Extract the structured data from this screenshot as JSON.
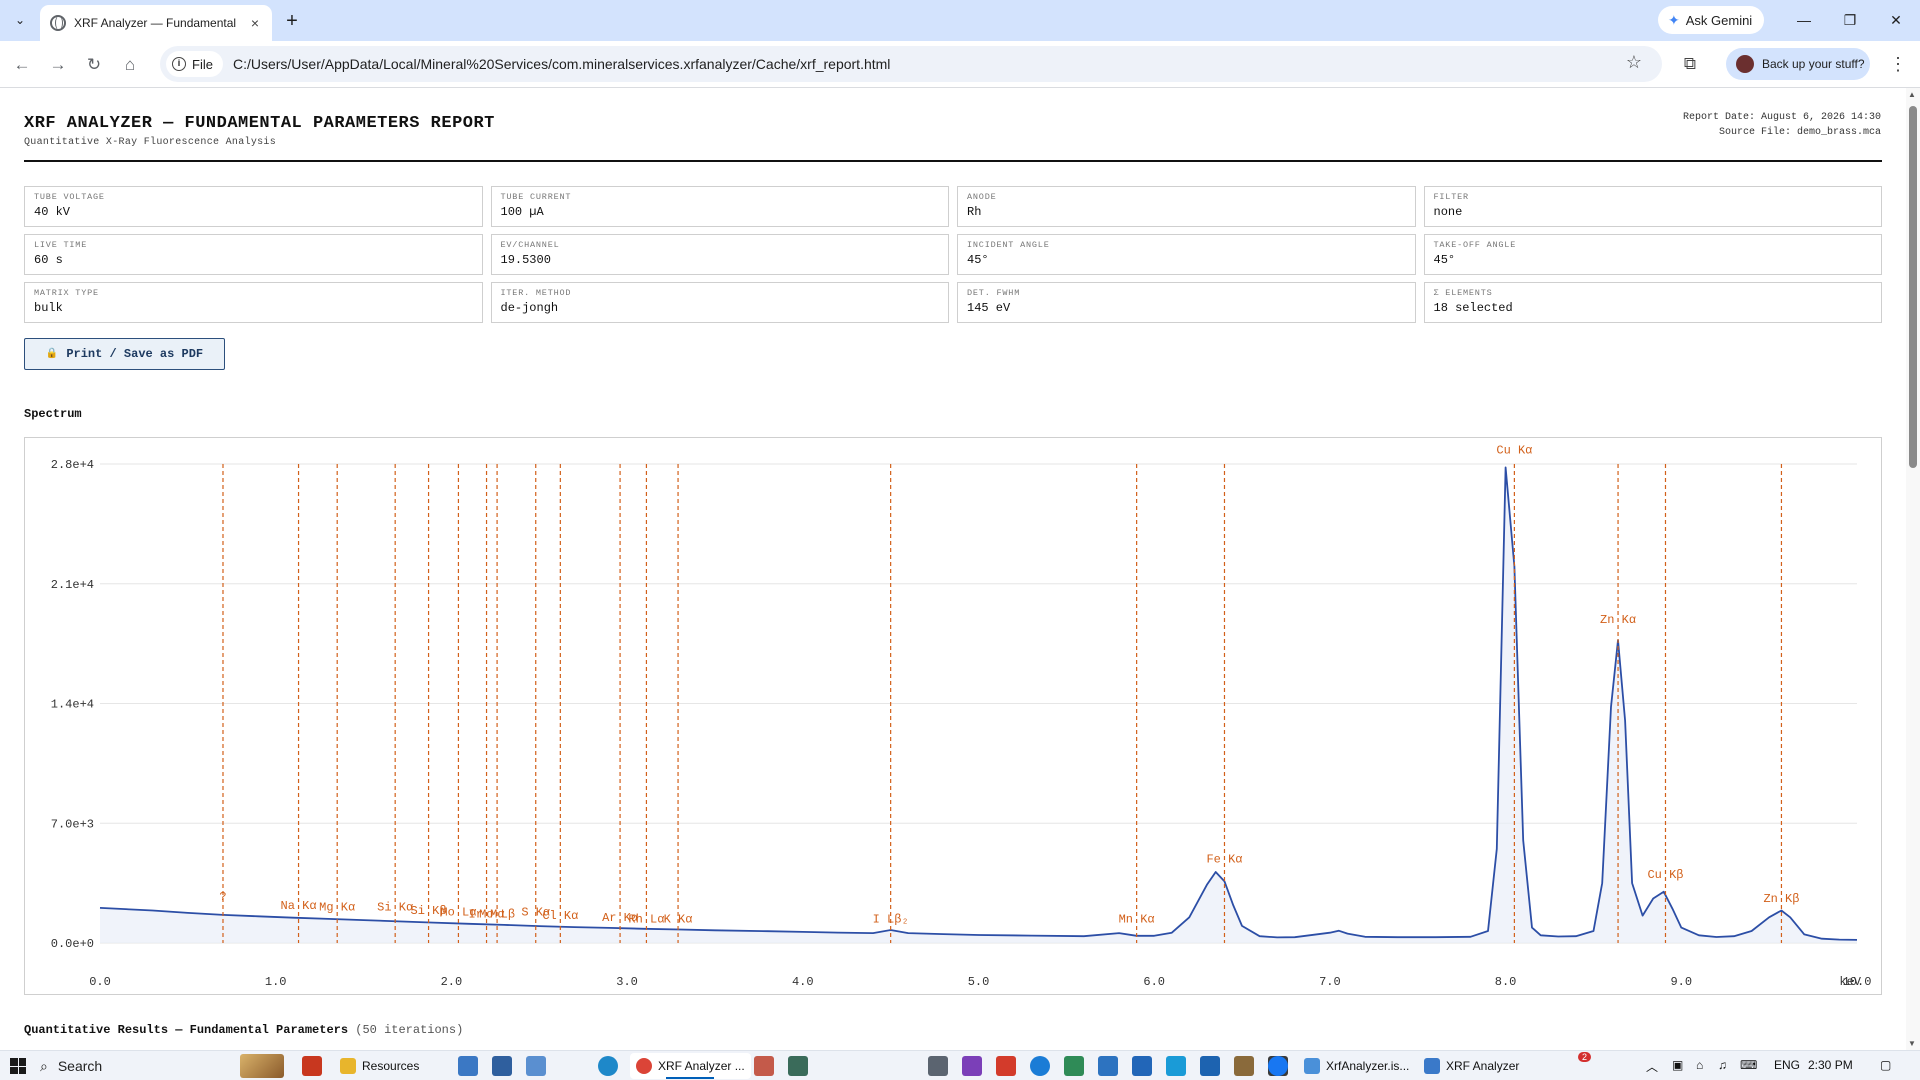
{
  "browser": {
    "tab_title": "XRF Analyzer — Fundamental P",
    "gemini_label": "Ask Gemini",
    "url_scheme": "File",
    "url": "C:/Users/User/AppData/Local/Mineral%20Services/com.mineralservices.xrfanalyzer/Cache/xrf_report.html",
    "backup_label": "Back up your stuff?"
  },
  "report": {
    "title": "XRF ANALYZER — FUNDAMENTAL PARAMETERS REPORT",
    "subtitle": "Quantitative X-Ray Fluorescence Analysis",
    "report_date": "Report Date: August 6, 2026 14:30",
    "source_file": "Source File: demo_brass.mca",
    "params": [
      {
        "label": "TUBE VOLTAGE",
        "value": "40 kV"
      },
      {
        "label": "TUBE CURRENT",
        "value": "100 µA"
      },
      {
        "label": "ANODE",
        "value": "Rh"
      },
      {
        "label": "FILTER",
        "value": "none"
      },
      {
        "label": "LIVE TIME",
        "value": "60 s"
      },
      {
        "label": "EV/CHANNEL",
        "value": "19.5300"
      },
      {
        "label": "INCIDENT ANGLE",
        "value": "45°"
      },
      {
        "label": "TAKE-OFF ANGLE",
        "value": "45°"
      },
      {
        "label": "MATRIX TYPE",
        "value": "bulk"
      },
      {
        "label": "ITER. METHOD",
        "value": "de-jongh"
      },
      {
        "label": "DET. FWHM",
        "value": "145 eV"
      },
      {
        "label": "Σ ELEMENTS",
        "value": "18 selected"
      }
    ],
    "print_label": "Print / Save as PDF",
    "spectrum_heading": "Spectrum",
    "quant_heading": "Quantitative Results — Fundamental Parameters",
    "quant_iterations": "(50 iterations)"
  },
  "chart_data": {
    "type": "line",
    "xlabel": "keV",
    "ylabel": "",
    "xlim": [
      0,
      10
    ],
    "ylim": [
      0,
      28000
    ],
    "x_ticks": [
      "0.0",
      "1.0",
      "2.0",
      "3.0",
      "4.0",
      "5.0",
      "6.0",
      "7.0",
      "8.0",
      "9.0",
      "10.0"
    ],
    "y_ticks": [
      "0.0e+0",
      "7.0e+3",
      "1.4e+4",
      "2.1e+4",
      "2.8e+4"
    ],
    "grid": true,
    "series_color": "#2c4ea6",
    "marker_color": "#d2601a",
    "series": [
      {
        "x": [
          0.0,
          0.3,
          0.5,
          0.7,
          0.9,
          1.1,
          1.3,
          1.5,
          1.7,
          1.9,
          2.1,
          2.3,
          2.5,
          2.7,
          2.9,
          3.1,
          3.3,
          3.5,
          3.8,
          4.0,
          4.2,
          4.4,
          4.5,
          4.6,
          4.8,
          5.0,
          5.3,
          5.6,
          5.8,
          5.9,
          6.0,
          6.1,
          6.2,
          6.3,
          6.35,
          6.4,
          6.45,
          6.5,
          6.6,
          6.7,
          6.8,
          7.0,
          7.05,
          7.1,
          7.2,
          7.4,
          7.6,
          7.8,
          7.9,
          7.95,
          8.0,
          8.05,
          8.1,
          8.15,
          8.2,
          8.3,
          8.4,
          8.5,
          8.55,
          8.6,
          8.64,
          8.68,
          8.72,
          8.78,
          8.84,
          8.9,
          8.95,
          9.0,
          9.1,
          9.2,
          9.3,
          9.4,
          9.5,
          9.57,
          9.62,
          9.7,
          9.8,
          9.9,
          10.0
        ],
        "y": [
          2050,
          1900,
          1760,
          1640,
          1560,
          1480,
          1410,
          1340,
          1260,
          1190,
          1120,
          1060,
          990,
          930,
          880,
          830,
          790,
          740,
          690,
          650,
          610,
          580,
          760,
          580,
          520,
          470,
          430,
          400,
          580,
          420,
          420,
          600,
          1500,
          3400,
          4150,
          3600,
          2200,
          1000,
          400,
          330,
          340,
          600,
          720,
          550,
          360,
          340,
          340,
          360,
          700,
          5500,
          27800,
          22000,
          6000,
          900,
          450,
          380,
          400,
          700,
          3500,
          13800,
          17700,
          13000,
          3500,
          1600,
          2600,
          3000,
          2000,
          900,
          450,
          350,
          400,
          700,
          1500,
          1900,
          1500,
          500,
          250,
          200,
          180
        ]
      }
    ],
    "markers": [
      {
        "x": 0.7,
        "label": "?",
        "label_y": 2500
      },
      {
        "x": 1.13,
        "label": "Na Kα",
        "label_y": 2000
      },
      {
        "x": 1.35,
        "label": "Mg Kα",
        "label_y": 1900
      },
      {
        "x": 1.68,
        "label": "Si Kα",
        "label_y": 1900
      },
      {
        "x": 1.87,
        "label": "Si Kβ",
        "label_y": 1700
      },
      {
        "x": 2.04,
        "label": "Mo Lα",
        "label_y": 1600
      },
      {
        "x": 2.2,
        "label": "Ir Mα",
        "label_y": 1500
      },
      {
        "x": 2.26,
        "label": "Mo Lβ",
        "label_y": 1500
      },
      {
        "x": 2.48,
        "label": "S Kα",
        "label_y": 1600
      },
      {
        "x": 2.62,
        "label": "Cl Kα",
        "label_y": 1400
      },
      {
        "x": 2.96,
        "label": "Ar Kα",
        "label_y": 1300
      },
      {
        "x": 3.11,
        "label": "Rh Lα",
        "label_y": 1200
      },
      {
        "x": 3.29,
        "label": "K Kα",
        "label_y": 1200
      },
      {
        "x": 4.5,
        "label": "I Lβ₂",
        "label_y": 1200
      },
      {
        "x": 5.9,
        "label": "Mn Kα",
        "label_y": 1200
      },
      {
        "x": 6.4,
        "label": "Fe Kα",
        "label_y": 4700
      },
      {
        "x": 8.05,
        "label": "Cu Kα",
        "label_y": 28600
      },
      {
        "x": 8.64,
        "label": "Zn Kα",
        "label_y": 18700
      },
      {
        "x": 8.91,
        "label": "Cu Kβ",
        "label_y": 3800
      },
      {
        "x": 9.57,
        "label": "Zn Kβ",
        "label_y": 2400
      }
    ]
  },
  "taskbar": {
    "search_label": "Search",
    "apps": [
      {
        "label": "Resources"
      },
      {
        "label": "XRF Analyzer ..."
      },
      {
        "label": "XrfAnalyzer.is..."
      },
      {
        "label": "XRF Analyzer"
      }
    ],
    "badge": "2",
    "lang": "ENG",
    "time": "2:30 PM"
  }
}
